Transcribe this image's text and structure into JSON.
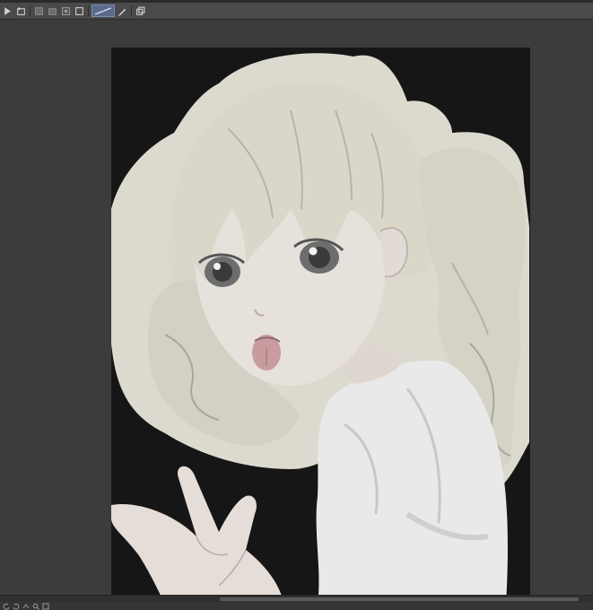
{
  "app": {
    "name": "",
    "colors": {
      "background": "#3c3c3c",
      "toolbar": "#4a4a4a",
      "active_tool": "#5b6b8c",
      "canvas_background": "#161616",
      "backlight": "#dcdacf",
      "hair": "#d8d7ca",
      "skin": "#e7e1dc",
      "shirt": "#e9e9e9"
    }
  },
  "toolbar": {
    "items": [
      {
        "icon": "play-icon"
      },
      {
        "icon": "new-layer-icon"
      },
      {
        "icon": "new-vector-layer-icon"
      },
      {
        "icon": "new-folder-icon"
      },
      {
        "icon": "mask-icon"
      },
      {
        "icon": "selection-icon"
      },
      {
        "icon": "ruler-icon",
        "active": true
      },
      {
        "icon": "pen-icon"
      },
      {
        "icon": "transform-icon"
      }
    ]
  },
  "canvas": {
    "artwork": "anime-girl-illustration"
  },
  "statusbar": {
    "items": [
      {
        "icon": "rotate-left-icon"
      },
      {
        "icon": "rotate-right-icon"
      },
      {
        "icon": "flip-icon"
      },
      {
        "icon": "zoom-icon"
      },
      {
        "icon": "fit-icon"
      }
    ]
  }
}
